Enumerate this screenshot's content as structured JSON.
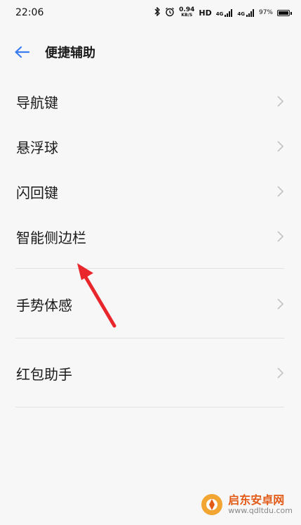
{
  "status_bar": {
    "time": "22:06",
    "speed_value": "0.94",
    "speed_unit": "KB/S",
    "hd_label": "HD",
    "network_1": "4G",
    "network_2": "4G",
    "battery": "97%"
  },
  "header": {
    "title": "便捷辅助"
  },
  "list_group_1": [
    {
      "label": "导航键"
    },
    {
      "label": "悬浮球"
    },
    {
      "label": "闪回键"
    },
    {
      "label": "智能侧边栏"
    }
  ],
  "list_group_2": [
    {
      "label": "手势体感"
    }
  ],
  "list_group_3": [
    {
      "label": "红包助手"
    }
  ],
  "watermark": {
    "name": "启东安卓网",
    "url": "www.qdltdu.com"
  },
  "colors": {
    "accent_blue": "#3b7cf0",
    "arrow_red": "#e8262b",
    "chevron": "#c4c4c4",
    "divider": "#e2e2e2",
    "watermark_orange": "#e25a16"
  }
}
